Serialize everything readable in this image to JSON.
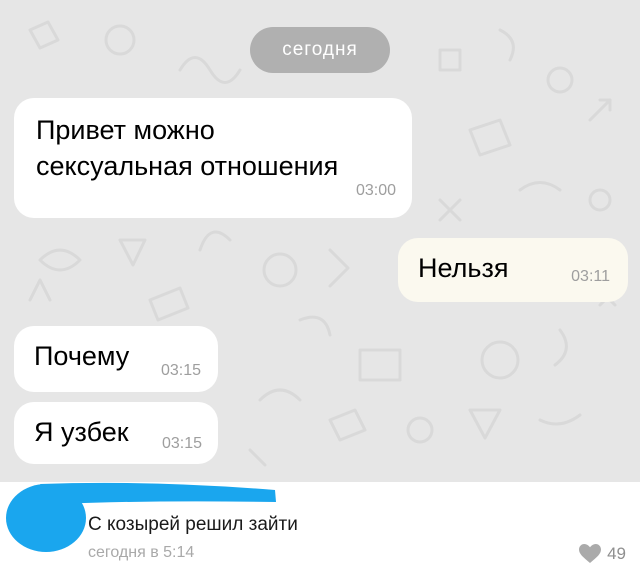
{
  "chat": {
    "date_label": "сегодня",
    "messages": [
      {
        "direction": "incoming",
        "text": "Привет можно\nсексуальная отношения",
        "time": "03:00"
      },
      {
        "direction": "outgoing",
        "text": "Нельзя",
        "time": "03:11"
      },
      {
        "direction": "incoming",
        "text": "Почему",
        "time": "03:15"
      },
      {
        "direction": "incoming",
        "text": "Я узбек",
        "time": "03:15"
      }
    ]
  },
  "comment": {
    "text": "С козырей решил зайти",
    "time": "сегодня в 5:14",
    "likes": "49",
    "like_icon": "heart-icon"
  },
  "colors": {
    "chat_background": "#e6e6e6",
    "incoming_bubble": "#ffffff",
    "outgoing_bubble": "#fbf9ef",
    "date_pill": "#b0b0b0",
    "redaction_scribble": "#1aa6ee"
  }
}
